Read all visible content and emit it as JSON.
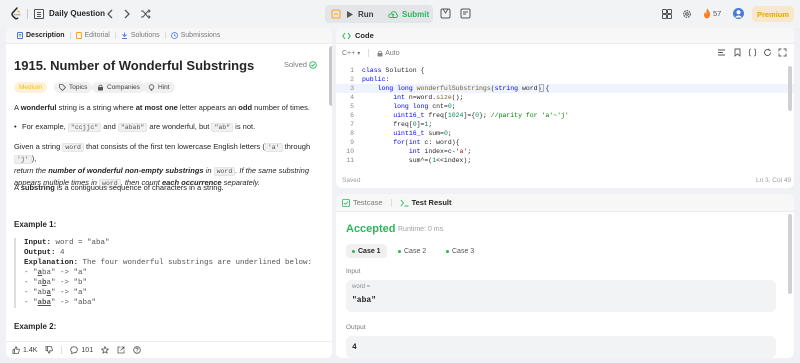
{
  "topbar": {
    "daily_question": "Daily Question",
    "run": "Run",
    "submit": "Submit",
    "streak": "57",
    "premium": "Premium",
    "colors": {
      "accent": "#ffa116",
      "submit": "#2db55d",
      "premium": "#e6a700"
    }
  },
  "problem": {
    "tabs": [
      {
        "label": "Description",
        "icon": "description-icon"
      },
      {
        "label": "Editorial",
        "icon": "editorial-icon"
      },
      {
        "label": "Solutions",
        "icon": "solutions-icon"
      },
      {
        "label": "Submissions",
        "icon": "submissions-icon"
      }
    ],
    "title": "1915. Number of Wonderful Substrings",
    "solved": "Solved",
    "tags": {
      "difficulty": "Medium",
      "topics": "Topics",
      "companies": "Companies",
      "hint": "Hint"
    },
    "p1": {
      "a": "A ",
      "b": "wonderful",
      "c": " string is a string where ",
      "d": "at most one",
      "e": " letter appears an ",
      "f": "odd",
      "g": " number of times."
    },
    "p2": {
      "a": "For example, ",
      "c1": "\"ccjjc\"",
      "b": " and ",
      "c2": "\"abab\"",
      "c": " are wonderful, but ",
      "c3": "\"ab\"",
      "d": " is not."
    },
    "p3": {
      "a": "Given a string ",
      "c1": "word",
      "b": " that consists of the first ten lowercase English letters (",
      "c2": "'a'",
      "c": " through ",
      "c3": "'j'",
      "d": "),",
      "e": "return the ",
      "f": "number of wonderful non-empty substrings",
      "g": " in ",
      "c4": "word",
      "h": ". If the same substring",
      "i": "appears multiple times in ",
      "c5": "word",
      "j": ", then count ",
      "k": "each occurrence",
      "l": " separately."
    },
    "p4": {
      "a": "A ",
      "b": "substring",
      "c": " is a contiguous sequence of characters in a string."
    },
    "example1": {
      "title": "Example 1:",
      "input_label": "Input:",
      "input": " word = \"aba\"",
      "output_label": "Output:",
      "output": " 4",
      "explanation_label": "Explanation:",
      "explanation": " The four wonderful substrings are underlined below:",
      "l1a": "- \"",
      "l1u": "a",
      "l1b": "ba\" -> \"a\"",
      "l2a": "- \"a",
      "l2u": "b",
      "l2b": "a\" -> \"b\"",
      "l3a": "- \"ab",
      "l3u": "a",
      "l3b": "\" -> \"a\"",
      "l4a": "- \"",
      "l4u": "aba",
      "l4b": "\" -> \"aba\""
    },
    "example2_title": "Example 2:",
    "footer": {
      "likes": "1.4K",
      "comments": "101"
    }
  },
  "editor": {
    "title": "Code",
    "language": "C++",
    "mode": "Auto",
    "lines": [
      {
        "n": "1",
        "text": "class Solution {"
      },
      {
        "n": "2",
        "text": "public:"
      },
      {
        "n": "3",
        "text": "    long long wonderfulSubstrings(string word) {"
      },
      {
        "n": "4",
        "text": "        int n=word.size();"
      },
      {
        "n": "5",
        "text": "        long long cnt=0;"
      },
      {
        "n": "6",
        "text": "        uint16_t freq[1024]={0}; //parity for 'a'~'j'"
      },
      {
        "n": "7",
        "text": "        freq[0]=1;"
      },
      {
        "n": "8",
        "text": "        uint16_t sum=0;"
      },
      {
        "n": "9",
        "text": "        for(int c: word){"
      },
      {
        "n": "10",
        "text": "            int index=c-'a';"
      },
      {
        "n": "11",
        "text": "            sum^=(1<<index);"
      }
    ],
    "status": "Saved",
    "position": "Ln 3, Col 49"
  },
  "result": {
    "tabs": [
      {
        "label": "Testcase"
      },
      {
        "label": "Test Result"
      }
    ],
    "verdict": "Accepted",
    "runtime": "Runtime: 0 ms",
    "cases": [
      "Case 1",
      "Case 2",
      "Case 3"
    ],
    "input_label": "Input",
    "var_name": "word =",
    "input_value": "\"aba\"",
    "output_label": "Output",
    "output_value": "4"
  }
}
